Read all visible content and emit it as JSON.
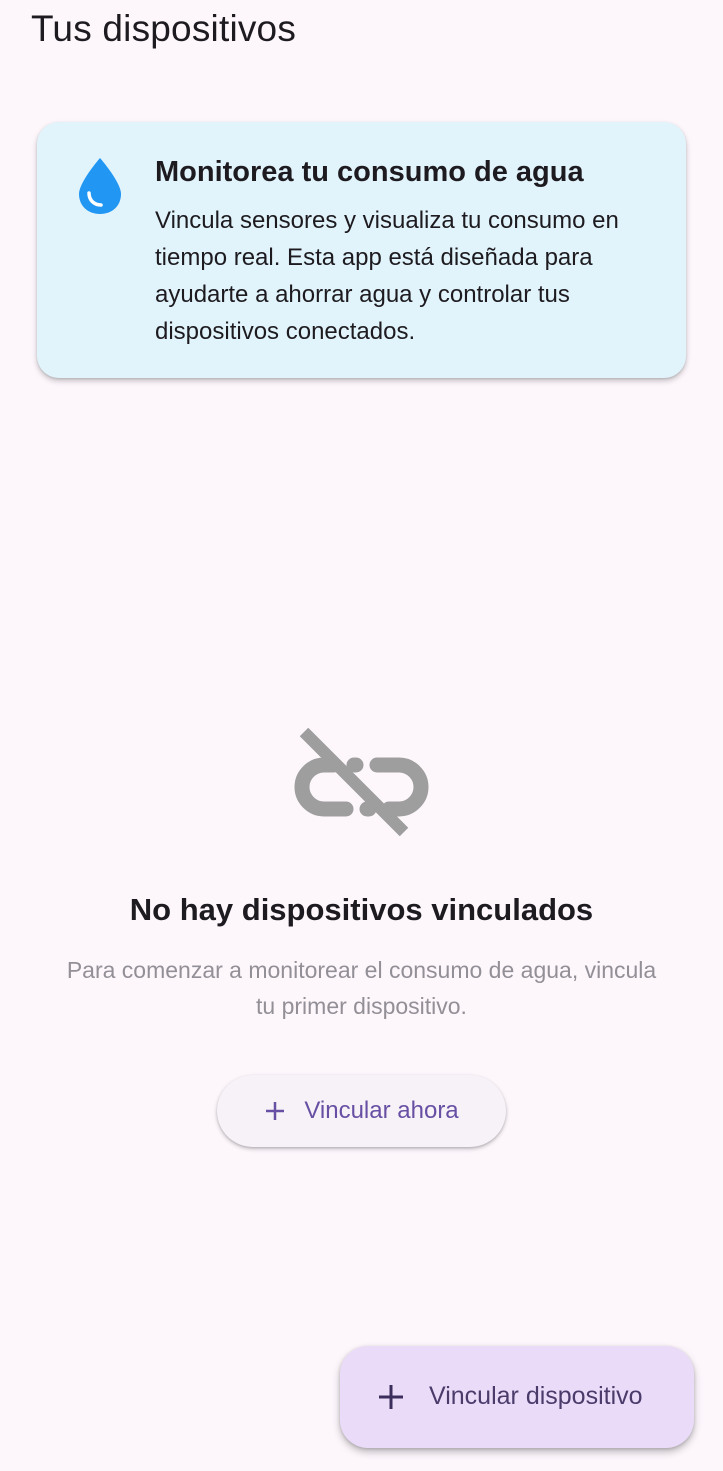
{
  "header": {
    "title": "Tus dispositivos"
  },
  "info_card": {
    "icon": "water-drop-icon",
    "title": "Monitorea tu consumo de agua",
    "text": "Vincula sensores y visualiza tu consumo en tiempo real. Esta app está diseñada para ayudarte a ahorrar agua y controlar tus dispositivos conectados.",
    "background_color": "#e2f4fb",
    "icon_color": "#2196f3"
  },
  "empty_state": {
    "icon": "link-off-icon",
    "title": "No hay dispositivos vinculados",
    "description": "Para comenzar a monitorear el consumo de agua, vincula tu primer dispositivo.",
    "button_label": "Vincular ahora",
    "button_icon": "plus-icon"
  },
  "fab": {
    "label": "Vincular dispositivo",
    "icon": "plus-icon",
    "background_color": "#eadcf8"
  },
  "colors": {
    "background": "#fdf7fc",
    "accent": "#6750a4",
    "muted_text": "#938f96",
    "icon_gray": "#9e9e9e"
  }
}
